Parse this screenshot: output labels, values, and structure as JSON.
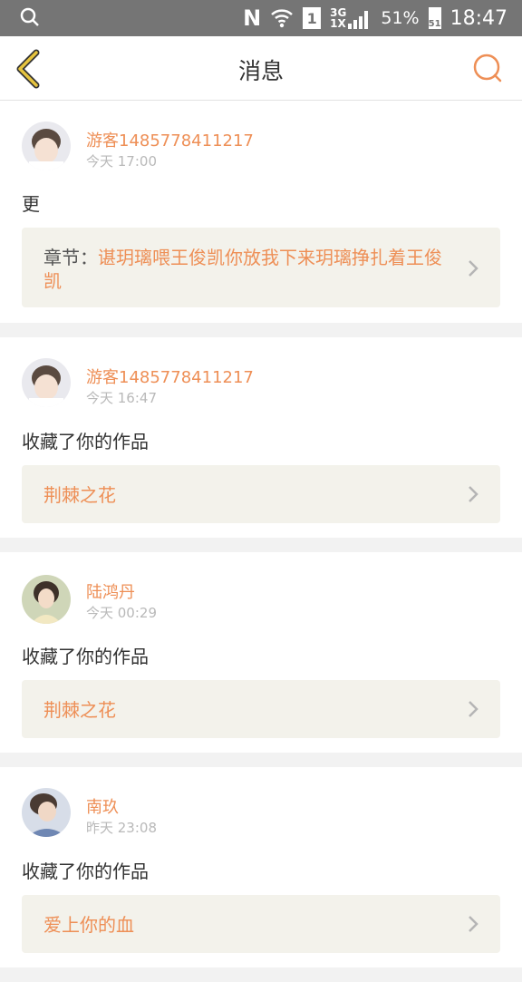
{
  "status_bar": {
    "battery": "51%",
    "battery_level": "51",
    "time": "18:47",
    "net_3g": "3G",
    "net_1x": "1X",
    "sim_slot": "1",
    "nfc": "N"
  },
  "header": {
    "title": "消息"
  },
  "messages": [
    {
      "user": "游客1485778411217",
      "time": "今天 17:00",
      "content": "更",
      "link_prefix": "章节：",
      "link": "谌玥璃喂王俊凯你放我下来玥璃挣扎着王俊凯"
    },
    {
      "user": "游客1485778411217",
      "time": "今天 16:47",
      "content": "收藏了你的作品",
      "link": "荆棘之花"
    },
    {
      "user": "陆鸿丹",
      "time": "今天 00:29",
      "content": "收藏了你的作品",
      "link": "荆棘之花"
    },
    {
      "user": "南玖",
      "time": "昨天 23:08",
      "content": "收藏了你的作品",
      "link": "爱上你的血"
    }
  ],
  "colors": {
    "accent": "#ee8f56",
    "back_arrow": "#e6c43f",
    "status_bar": "#757575",
    "link_bg": "#f3f2eb"
  }
}
